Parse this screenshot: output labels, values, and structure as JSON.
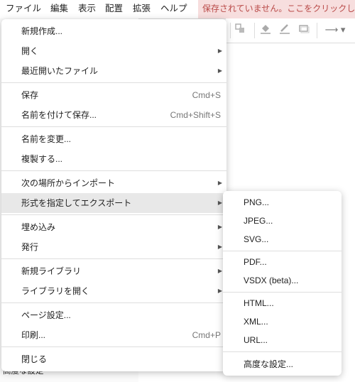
{
  "menubar": {
    "items": [
      "ファイル",
      "編集",
      "表示",
      "配置",
      "拡張",
      "ヘルプ"
    ],
    "unsaved_notice": "保存されていません。ここをクリックして保存"
  },
  "toolbar": {
    "icons": [
      "group-icon",
      "fill-color-icon",
      "line-color-icon",
      "shadow-icon",
      "connector-arrow-icon"
    ]
  },
  "sidepanel": {
    "partial_label": "高度な設定"
  },
  "file_menu": {
    "items": [
      {
        "label": "新規作成...",
        "shortcut": "",
        "submenu": false
      },
      {
        "label": "開く",
        "shortcut": "",
        "submenu": true
      },
      {
        "label": "最近開いたファイル",
        "shortcut": "",
        "submenu": true
      },
      {
        "label": "保存",
        "shortcut": "Cmd+S",
        "submenu": false
      },
      {
        "label": "名前を付けて保存...",
        "shortcut": "Cmd+Shift+S",
        "submenu": false
      },
      {
        "label": "名前を変更...",
        "shortcut": "",
        "submenu": false
      },
      {
        "label": "複製する...",
        "shortcut": "",
        "submenu": false
      },
      {
        "label": "次の場所からインポート",
        "shortcut": "",
        "submenu": true
      },
      {
        "label": "形式を指定してエクスポート",
        "shortcut": "",
        "submenu": true,
        "selected": true
      },
      {
        "label": "埋め込み",
        "shortcut": "",
        "submenu": true
      },
      {
        "label": "発行",
        "shortcut": "",
        "submenu": true
      },
      {
        "label": "新規ライブラリ",
        "shortcut": "",
        "submenu": true
      },
      {
        "label": "ライブラリを開く",
        "shortcut": "",
        "submenu": true
      },
      {
        "label": "ページ設定...",
        "shortcut": "",
        "submenu": false
      },
      {
        "label": "印刷...",
        "shortcut": "Cmd+P",
        "submenu": false
      },
      {
        "label": "閉じる",
        "shortcut": "",
        "submenu": false
      }
    ]
  },
  "export_submenu": {
    "items": [
      {
        "label": "PNG..."
      },
      {
        "label": "JPEG..."
      },
      {
        "label": "SVG..."
      },
      {
        "label": "PDF..."
      },
      {
        "label": "VSDX (beta)..."
      },
      {
        "label": "HTML..."
      },
      {
        "label": "XML..."
      },
      {
        "label": "URL..."
      },
      {
        "label": "高度な設定..."
      }
    ]
  }
}
